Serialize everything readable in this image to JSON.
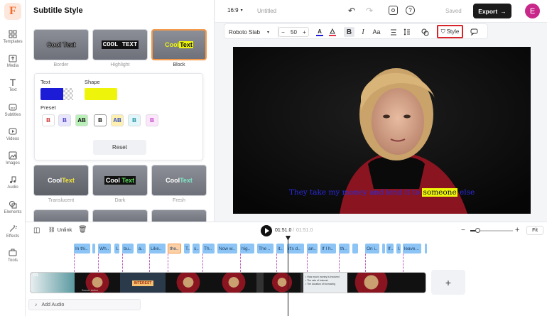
{
  "sidebar": {
    "items": [
      {
        "label": "Templates"
      },
      {
        "label": "Media"
      },
      {
        "label": "Text"
      },
      {
        "label": "Subtitles"
      },
      {
        "label": "Videos"
      },
      {
        "label": "Images"
      },
      {
        "label": "Audio"
      },
      {
        "label": "Elements"
      },
      {
        "label": "Effects"
      },
      {
        "label": "Tools"
      }
    ]
  },
  "panel": {
    "title": "Subtitle Style",
    "styles": [
      {
        "text": "Cool Text",
        "label": "Border"
      },
      {
        "text": "COOL TEXT",
        "label": "Highlight"
      },
      {
        "text_a": "Cool ",
        "text_b": "Text",
        "label": "Block"
      },
      {
        "text_a": "Cool ",
        "text_b": "Text",
        "label": "Translucent"
      },
      {
        "text_a": "Cool ",
        "text_b": "Text",
        "label": "Dark"
      },
      {
        "text_a": "Cool ",
        "text_b": "Text",
        "label": "Fresh"
      }
    ],
    "text_label": "Text",
    "shape_label": "Shape",
    "preset_label": "Preset",
    "text_color": "#1c1cd6",
    "shape_color": "#eef50a",
    "presets": [
      "B",
      "B",
      "AB",
      "B",
      "AB",
      "B",
      "B"
    ],
    "reset_label": "Reset"
  },
  "topbar": {
    "ratio": "16:9",
    "title": "Untitled",
    "saved": "Saved",
    "export": "Export",
    "avatar": "E"
  },
  "toolbar": {
    "font": "Roboto Slab",
    "size": "50",
    "minus": "−",
    "plus": "+",
    "bold": "B",
    "italic": "I",
    "case": "Aa",
    "style": "Style"
  },
  "video": {
    "subtitle_before": "They take my money and lend it to ",
    "subtitle_highlight": "someone",
    "subtitle_after": " else"
  },
  "timeline": {
    "unlink": "Unlink",
    "time_current": "01:51.0",
    "time_total": "01:51.0",
    "fit": "Fit",
    "add_audio": "Add Audio",
    "track_label": "01",
    "add_plus": "+",
    "chips": [
      "In thi..",
      "Wh..",
      "I..",
      "bu..",
      "a..",
      "Like..",
      "the..",
      "T..",
      "s..",
      "Th..",
      "Now w..",
      "hig..",
      "The ..",
      "it..",
      "it's d..",
      "an..",
      "If I h..",
      "th..",
      "On i..",
      "If..",
      "I..",
      "leave..."
    ],
    "frame_text": "INTEREST",
    "slide_lines": [
      "• How much money is involved",
      "• The rate of interest",
      "• The duration of borrowing"
    ],
    "source_text": "Source: Author"
  },
  "colors": {
    "accent": "#f26b2a",
    "export_bg": "#1b1b1b",
    "avatar_bg": "#c8288a",
    "chip": "#8bc4f5",
    "chip_selected": "#fbd0a6"
  }
}
